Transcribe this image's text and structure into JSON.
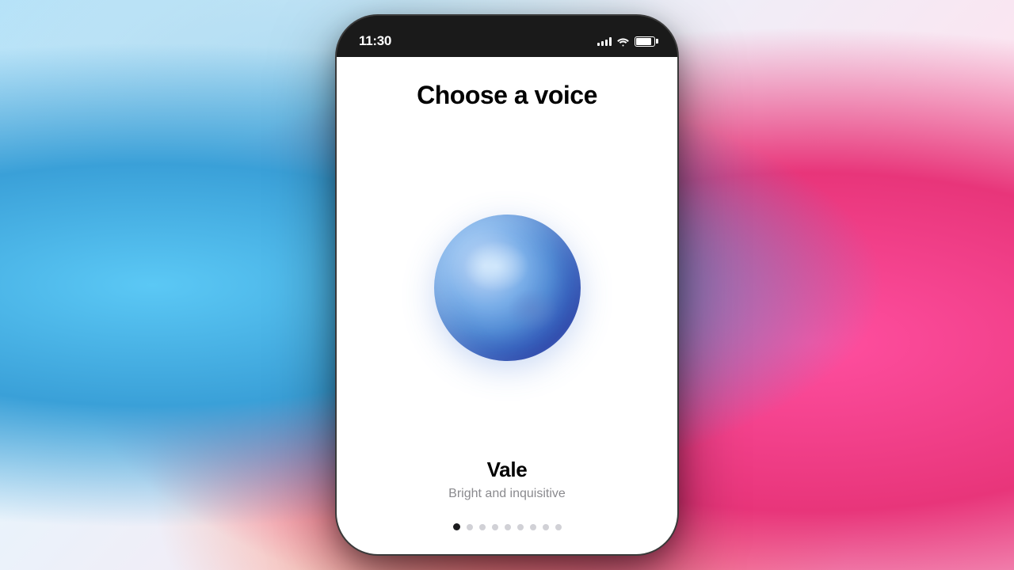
{
  "background": {
    "description": "colorful painted canvas background"
  },
  "phone": {
    "status_bar": {
      "time": "11:30",
      "signal_strength": 4,
      "wifi": true,
      "battery_percent": 85
    },
    "screen": {
      "title": "Choose a voice",
      "voice": {
        "name": "Vale",
        "description": "Bright and inquisitive",
        "avatar_alt": "blue gradient orb"
      },
      "pagination": {
        "total_dots": 9,
        "active_index": 0
      }
    }
  }
}
